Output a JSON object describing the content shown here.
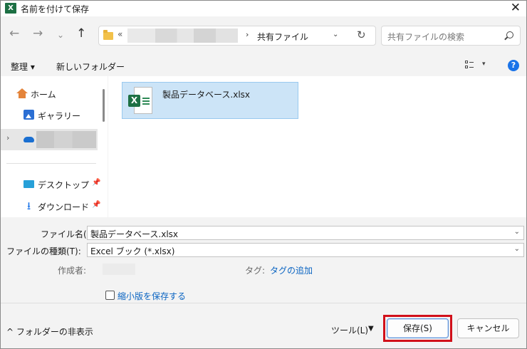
{
  "window": {
    "title": "名前を付けて保存",
    "app_icon": "excel-icon",
    "close_glyph": "✕"
  },
  "nav": {
    "back_glyph": "←",
    "forward_glyph": "→",
    "recent_glyph": "⌄",
    "up_glyph": "↑",
    "address_prefix": "«",
    "address_separator": "›",
    "address_current": "共有ファイル",
    "address_dropdown_glyph": "⌄",
    "refresh_glyph": "↻",
    "search_placeholder": "共有ファイルの検索"
  },
  "toolbar": {
    "organize": "整理 ▾",
    "new_folder": "新しいフォルダー",
    "view_dropdown": "▾",
    "help": "?"
  },
  "sidebar": {
    "items": [
      {
        "label": "ホーム",
        "icon": "home-icon"
      },
      {
        "label": "ギャラリー",
        "icon": "gallery-icon"
      },
      {
        "label": "デスクトップ",
        "icon": "desktop-icon",
        "pinned": true
      },
      {
        "label": "ダウンロード",
        "icon": "download-icon",
        "pinned": true
      }
    ],
    "cloud_chevron": "›",
    "pin_glyph": "📌"
  },
  "files": [
    {
      "name": "製品データベース.xlsx",
      "type": "excel",
      "badge": "X",
      "selected": true
    }
  ],
  "form": {
    "filename_label": "ファイル名(N):",
    "filename_value": "製品データベース.xlsx",
    "filetype_label": "ファイルの種類(T):",
    "filetype_value": "Excel ブック (*.xlsx)",
    "author_label": "作成者:",
    "tags_label": "タグ:",
    "tags_link": "タグの追加",
    "thumbnail_label": "縮小版を保存する",
    "thumbnail_checked": false,
    "chevron_glyph": "⌄"
  },
  "bottom": {
    "hide_folders": "^ フォルダーの非表示",
    "tools": "ツール(L)",
    "tools_drop": "▼",
    "save_button": "保存(S)",
    "cancel_button": "キャンセル"
  },
  "colors": {
    "accent": "#1a73e8",
    "excel_green": "#1d7044",
    "selection_bg": "#cce4f7",
    "highlight_border": "#d1101a"
  }
}
